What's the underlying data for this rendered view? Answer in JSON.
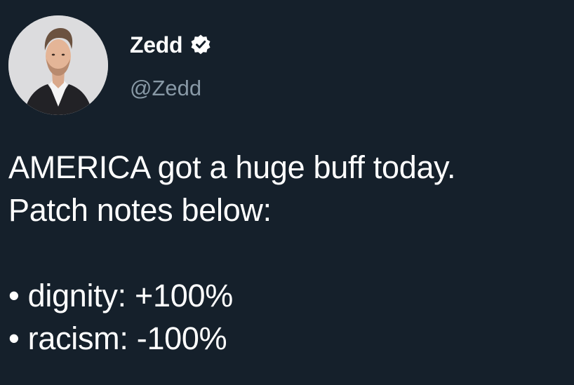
{
  "colors": {
    "background": "#15202b",
    "text": "#ffffff",
    "handle": "#8899a6",
    "verified_badge": "#ffffff"
  },
  "user": {
    "display_name": "Zedd",
    "handle": "@Zedd",
    "verified": true,
    "avatar_icon": "profile-photo"
  },
  "tweet": {
    "lines": [
      "AMERICA got a huge buff today.",
      "Patch notes below:",
      "",
      "• dignity: +100%",
      "• racism: -100%"
    ]
  }
}
